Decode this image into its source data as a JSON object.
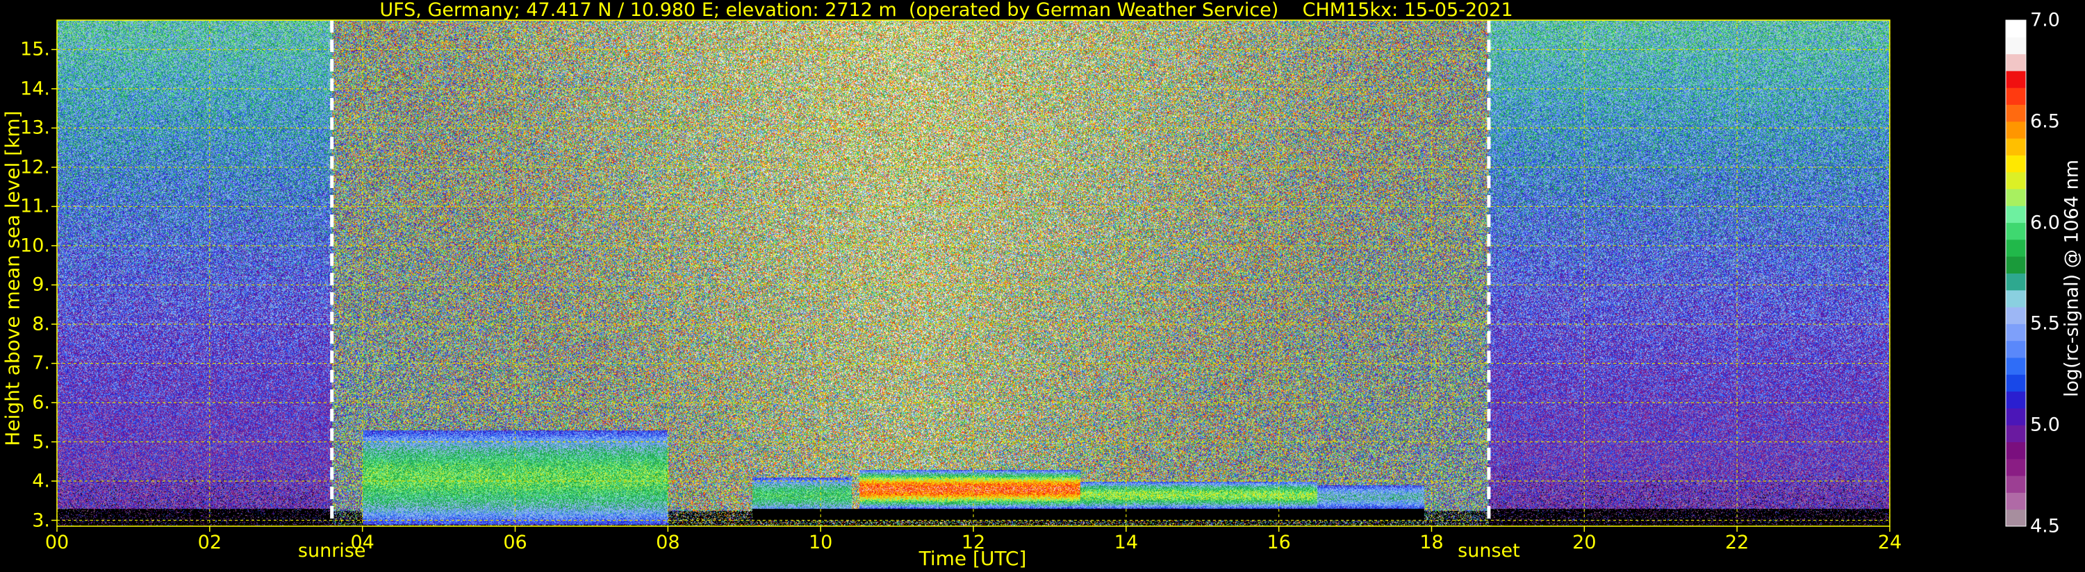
{
  "chart_data": {
    "type": "heatmap",
    "title": "UFS, Germany; 47.417 N / 10.980 E; elevation: 2712 m  (operated by German Weather Service)    CHM15kx: 15-05-2021",
    "xlabel": "Time [UTC]",
    "ylabel": "Height above mean sea level [km]",
    "x_ticks": [
      "00",
      "02",
      "04",
      "06",
      "08",
      "10",
      "12",
      "14",
      "16",
      "18",
      "20",
      "22",
      "24"
    ],
    "y_ticks": [
      "3.",
      "4.",
      "5.",
      "6.",
      "7.",
      "8.",
      "9.",
      "10.",
      "11.",
      "12.",
      "13.",
      "14.",
      "15."
    ],
    "xlim": [
      0,
      24
    ],
    "ylim": [
      2.85,
      15.75
    ],
    "grid": true,
    "annotations": [
      {
        "label": "sunrise",
        "x": 3.6
      },
      {
        "label": "sunset",
        "x": 18.75
      }
    ],
    "colorbar": {
      "label": "log(rc-signal) @ 1064 nm",
      "range": [
        4.5,
        7.0
      ],
      "ticks": [
        "4.5",
        "5.0",
        "5.5",
        "6.0",
        "6.5",
        "7.0"
      ],
      "colors": [
        "#a78e9e",
        "#b06aa6",
        "#9c3f93",
        "#8a1d84",
        "#7a0f7e",
        "#6a1aa0",
        "#4b16b8",
        "#2a1fd0",
        "#1848e8",
        "#2f6df7",
        "#5a88fa",
        "#7ea0fa",
        "#9db7f5",
        "#8ad0e0",
        "#2ea88f",
        "#1a9a3a",
        "#21b84a",
        "#3fd870",
        "#6ef0a0",
        "#a8f060",
        "#dcf026",
        "#ffe800",
        "#ffbf00",
        "#ff9600",
        "#ff6a10",
        "#ff3a10",
        "#f01010",
        "#f2c6c6",
        "#f8f8f8",
        "#ffffff"
      ]
    },
    "layers": [
      {
        "t0": 4.0,
        "t1": 8.0,
        "h0": 2.9,
        "h1": 5.3,
        "peak": 6.0
      },
      {
        "t0": 9.1,
        "t1": 10.4,
        "h0": 3.2,
        "h1": 4.1,
        "peak": 5.9
      },
      {
        "t0": 10.5,
        "t1": 13.4,
        "h0": 3.3,
        "h1": 4.3,
        "peak": 6.6
      },
      {
        "t0": 13.4,
        "t1": 16.5,
        "h0": 3.3,
        "h1": 4.0,
        "peak": 6.1
      },
      {
        "t0": 16.5,
        "t1": 17.9,
        "h0": 3.3,
        "h1": 3.9,
        "peak": 5.6
      }
    ]
  }
}
